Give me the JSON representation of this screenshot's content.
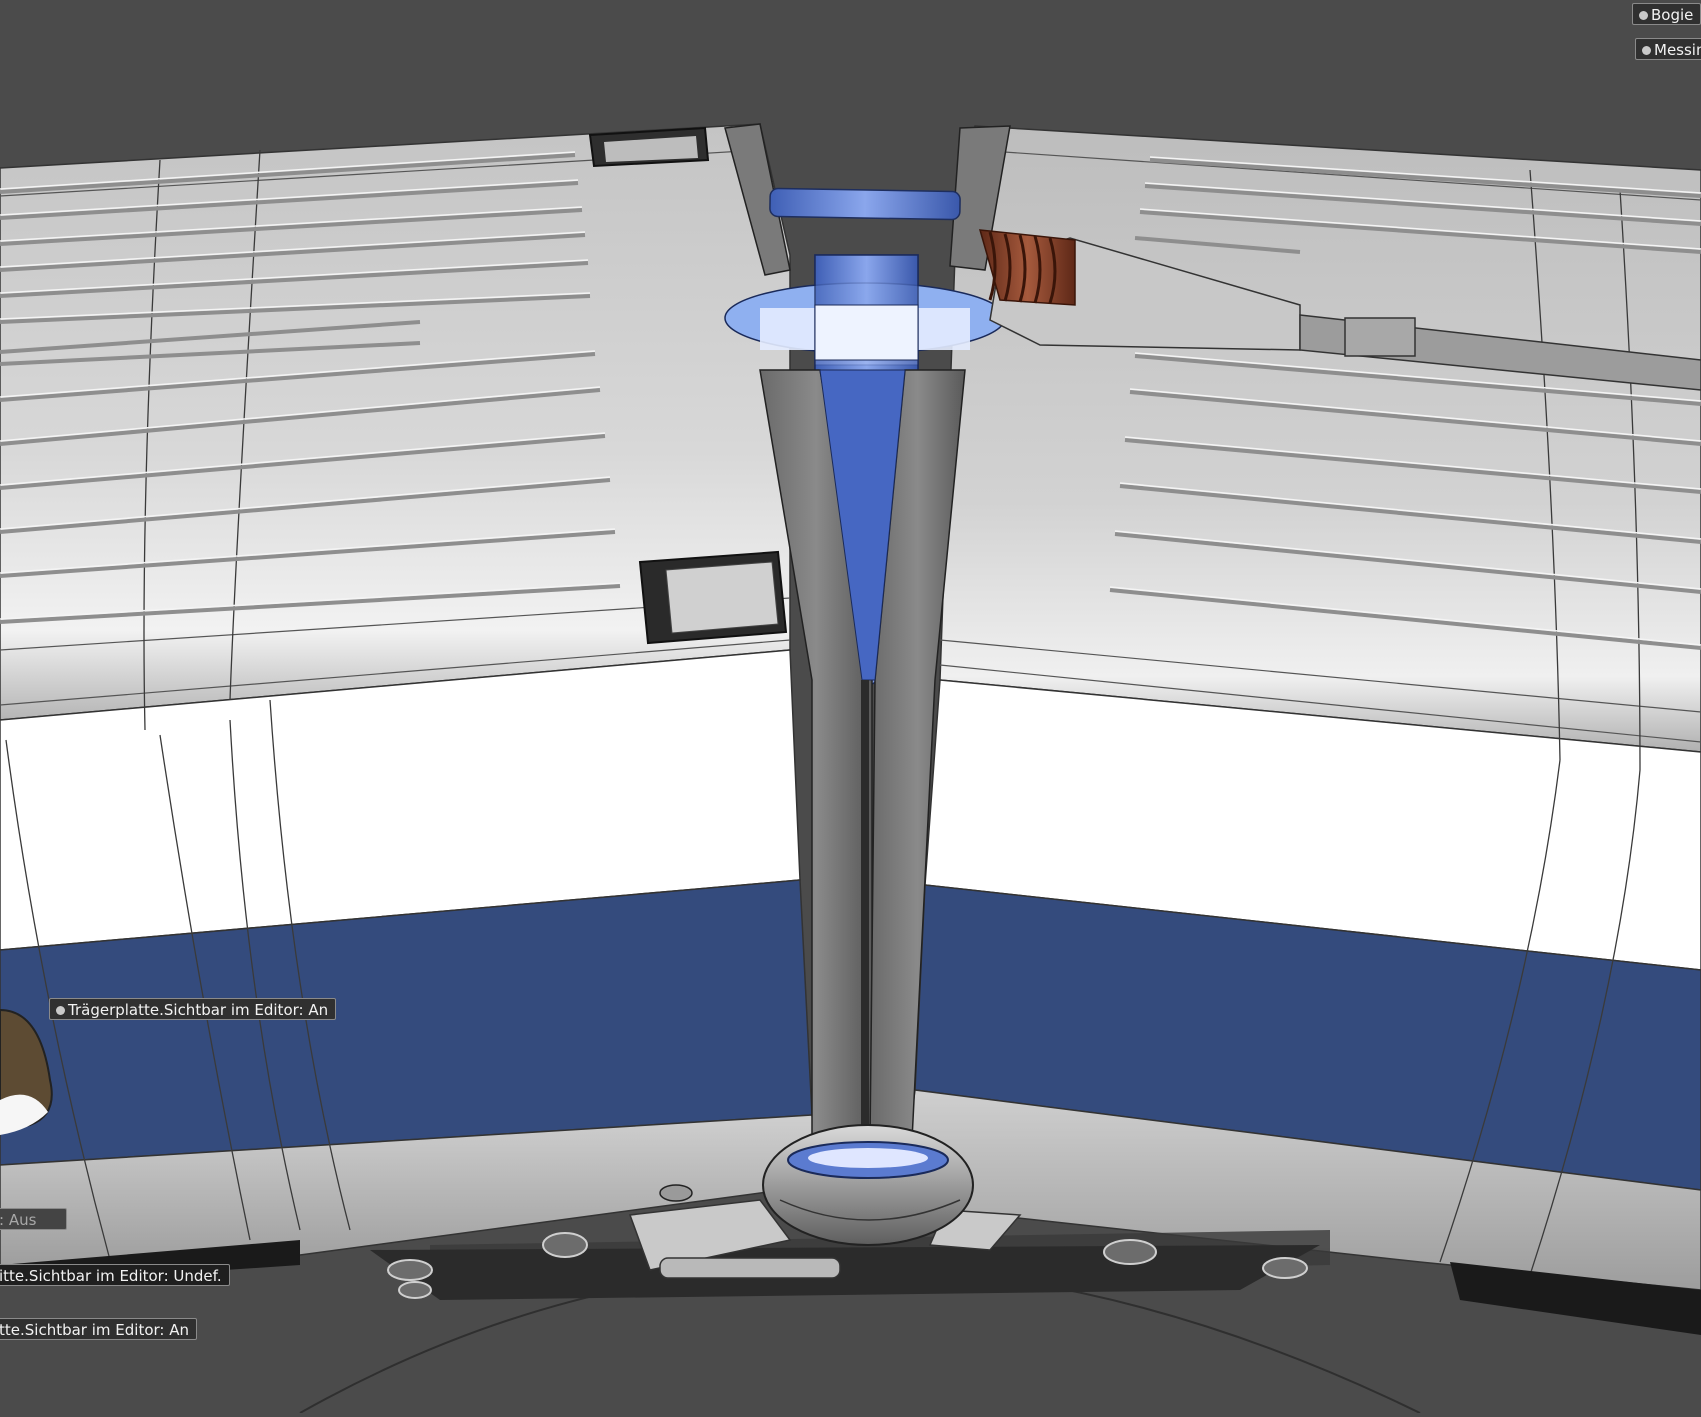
{
  "viewport": {
    "background_color": "#4b4b4b",
    "colors": {
      "hull_light": "#d6d6d6",
      "hull_mid": "#a9a9a9",
      "white_band": "#ffffff",
      "blue_band": "#334a7c",
      "selection_blue": "#5b7bd0",
      "spring": "#7e3a26",
      "bogie_dark": "#2e2e2e"
    }
  },
  "labels": {
    "top_right_1": "Bogie",
    "top_right_2": "Messin",
    "traegerplatte": "Trägerplatte.Sichtbar im Editor: An",
    "left_aus": ": Aus",
    "left_undef": "itte.Sichtbar im Editor: Undef.",
    "left_an": "tte.Sichtbar im Editor: An"
  }
}
